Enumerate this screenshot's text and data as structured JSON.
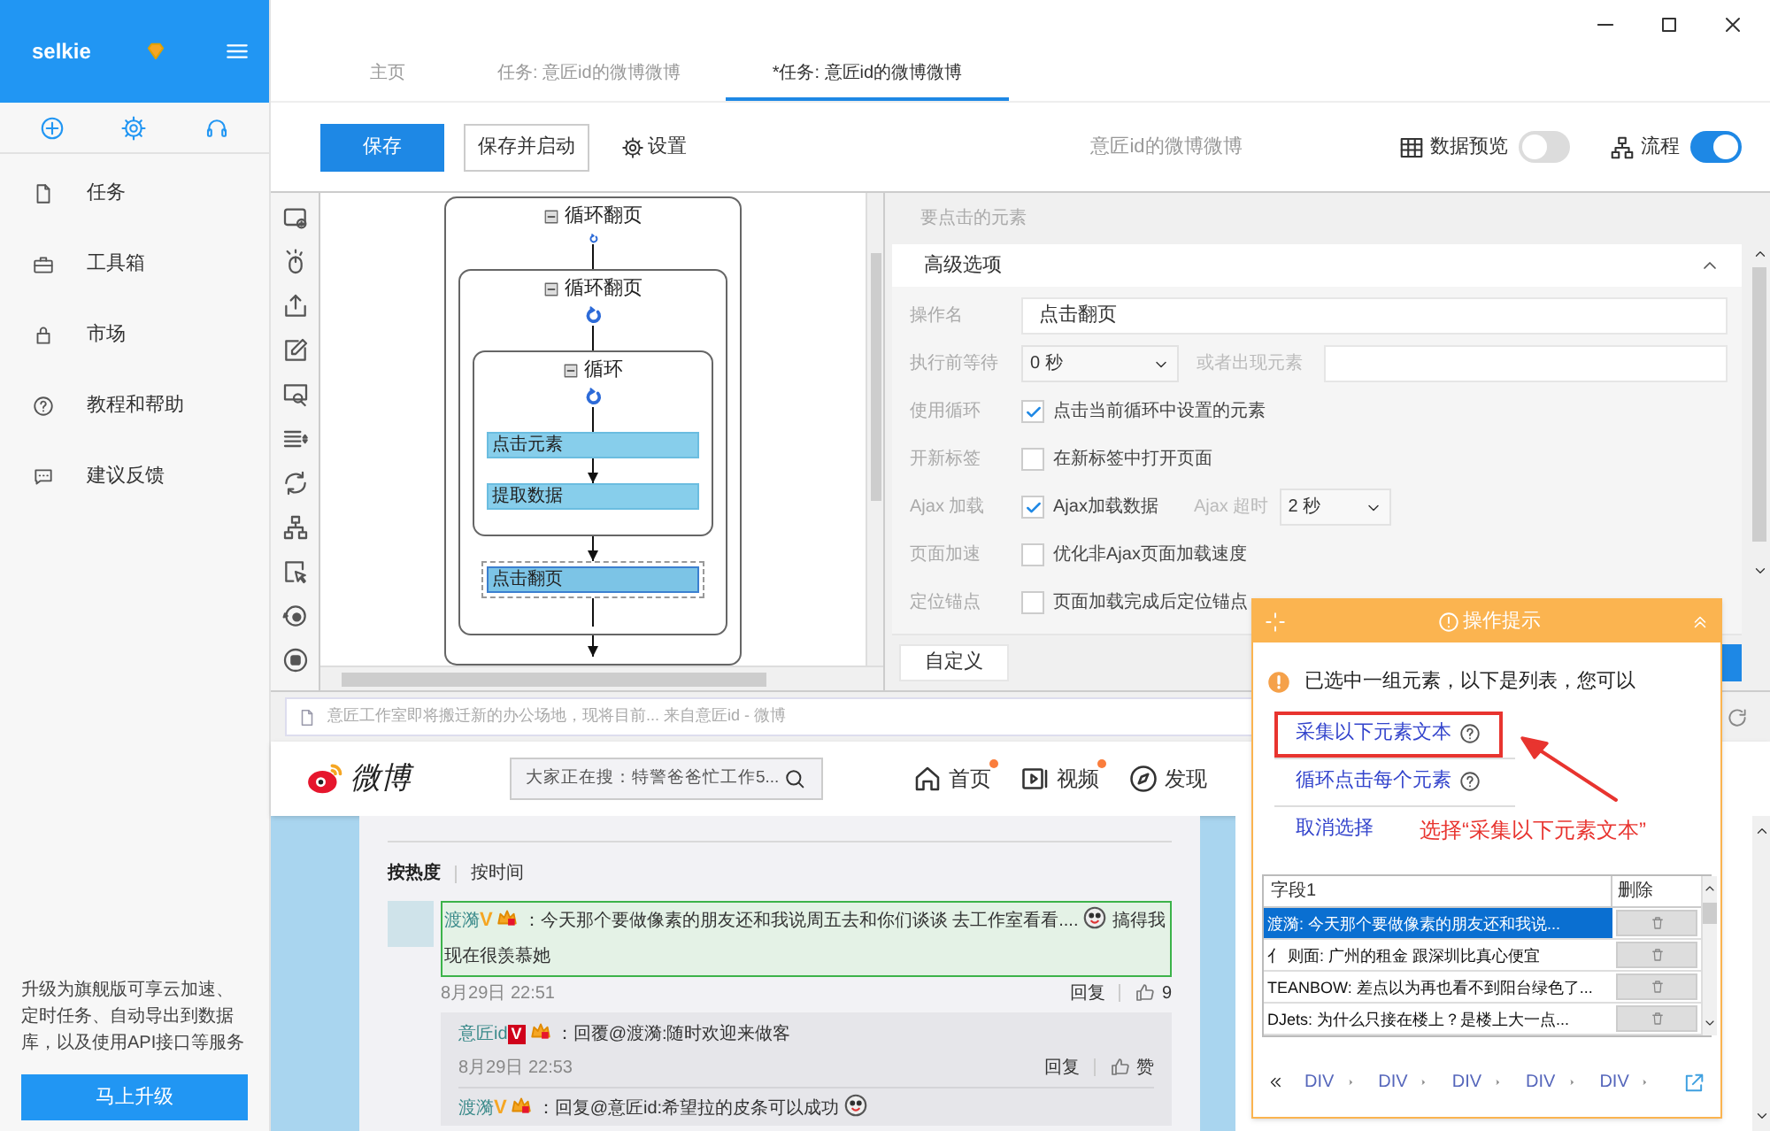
{
  "sidebar": {
    "user": "selkie",
    "items": [
      {
        "label": "任务"
      },
      {
        "label": "工具箱"
      },
      {
        "label": "市场"
      },
      {
        "label": "教程和帮助"
      },
      {
        "label": "建议反馈"
      }
    ],
    "promo": "升级为旗舰版可享云加速、定时任务、自动导出到数据库，以及使用API接口等服务",
    "upgrade_button": "马上升级"
  },
  "tabs": [
    {
      "label": "主页",
      "selected": false
    },
    {
      "label": "任务: 意匠id的微博微博",
      "selected": false
    },
    {
      "label": "*任务: 意匠id的微博微博",
      "selected": true
    }
  ],
  "toolbar": {
    "save": "保存",
    "save_and_start": "保存并启动",
    "settings": "设置",
    "task_title": "意匠id的微博微博",
    "data_preview": {
      "label": "数据预览",
      "on": false
    },
    "flow": {
      "label": "流程",
      "on": true
    }
  },
  "flow": {
    "nodes": [
      {
        "kind": "loop",
        "label": "循环翻页",
        "selected": false,
        "children": [
          {
            "kind": "loop",
            "label": "循环翻页",
            "selected": false,
            "children": [
              {
                "kind": "loop",
                "label": "循环",
                "selected": false,
                "children": [
                  {
                    "kind": "step",
                    "label": "点击元素",
                    "selected": false
                  },
                  {
                    "kind": "step",
                    "label": "提取数据",
                    "selected": false
                  }
                ]
              },
              {
                "kind": "step",
                "label": "点击翻页",
                "selected": true
              }
            ]
          }
        ]
      }
    ]
  },
  "options": {
    "element_label": "要点击的元素",
    "section": {
      "title": "高级选项",
      "expanded": true
    },
    "rows": [
      {
        "kind": "text",
        "label": "操作名",
        "value": "点击翻页"
      },
      {
        "kind": "select_text",
        "label": "执行前等待",
        "value": "0 秒",
        "extra_label": "或者出现元素"
      },
      {
        "kind": "checkbox",
        "label": "使用循环",
        "text": "点击当前循环中设置的元素",
        "checked": true
      },
      {
        "kind": "checkbox",
        "label": "开新标签",
        "text": "在新标签中打开页面",
        "checked": false
      },
      {
        "kind": "checkbox_select",
        "label": "Ajax 加载",
        "text": "Ajax加载数据",
        "checked": true,
        "select_label": "Ajax 超时",
        "value": "2 秒"
      },
      {
        "kind": "checkbox",
        "label": "页面加速",
        "text": "优化非Ajax页面加载速度",
        "checked": false
      },
      {
        "kind": "checkbox",
        "label": "定位锚点",
        "text": "页面加载完成后定位锚点",
        "checked": false
      }
    ],
    "custom_button": "自定义"
  },
  "browser": {
    "address": "意匠工作室即将搬迁新的办公场地，现将目前... 来自意匠id - 微博"
  },
  "weibo": {
    "logo": "微博",
    "search_placeholder": "大家正在搜：特警爸爸忙工作5...",
    "nav": [
      {
        "label": "首页",
        "dot": true
      },
      {
        "label": "视频",
        "dot": true
      },
      {
        "label": "发现",
        "dot": false
      }
    ],
    "sort": [
      {
        "label": "按热度",
        "selected": true
      },
      {
        "label": "按时间",
        "selected": false
      }
    ],
    "comments": [
      {
        "author": "渡漪",
        "verified": "V",
        "color": "#f5a623",
        "boxed": false,
        "text": "：今天那个要做像素的朋友还和我说周五去和你们谈谈 去工作室看看....",
        "text_after_emoji": "搞得我现在很羡慕她",
        "selected": true,
        "time": "8月29日 22:51",
        "reply": "回复",
        "likes": "9",
        "replies": [
          {
            "author": "意匠id",
            "verified": "V",
            "color": "#d0021b",
            "boxed": true,
            "text": "：回覆@渡漪:随时欢迎来做客",
            "emoji": false,
            "time": "8月29日 22:53",
            "reply": "回复",
            "likes": "赞"
          },
          {
            "author": "渡漪",
            "verified": "V",
            "color": "#f5a623",
            "boxed": false,
            "text": "：回复@意匠id:希望拉的皮条可以成功",
            "emoji": true
          }
        ]
      }
    ]
  },
  "popup": {
    "title": "操作提示",
    "message": "已选中一组元素，以下是列表，您可以",
    "actions": [
      {
        "label": "采集以下元素文本",
        "help": true,
        "highlighted": true
      },
      {
        "label": "循环点击每个元素",
        "help": true,
        "highlighted": false
      },
      {
        "label": "取消选择",
        "help": false,
        "highlighted": false
      }
    ],
    "table": {
      "columns": [
        "字段1",
        "删除"
      ],
      "rows": [
        {
          "text": "渡漪: 今天那个要做像素的朋友还和我说...",
          "selected": true
        },
        {
          "text": "亻 则面: 广州的租金 跟深圳比真心便宜",
          "selected": false
        },
        {
          "text": "TEANBOW: 差点以为再也看不到阳台绿色了...",
          "selected": false
        },
        {
          "text": "DJets: 为什么只接在楼上？是楼上大一点...",
          "selected": false
        }
      ]
    },
    "breadcrumb": [
      "DIV",
      "DIV",
      "DIV",
      "DIV",
      "DIV"
    ]
  },
  "annotation": {
    "text": "选择“采集以下元素文本”"
  }
}
